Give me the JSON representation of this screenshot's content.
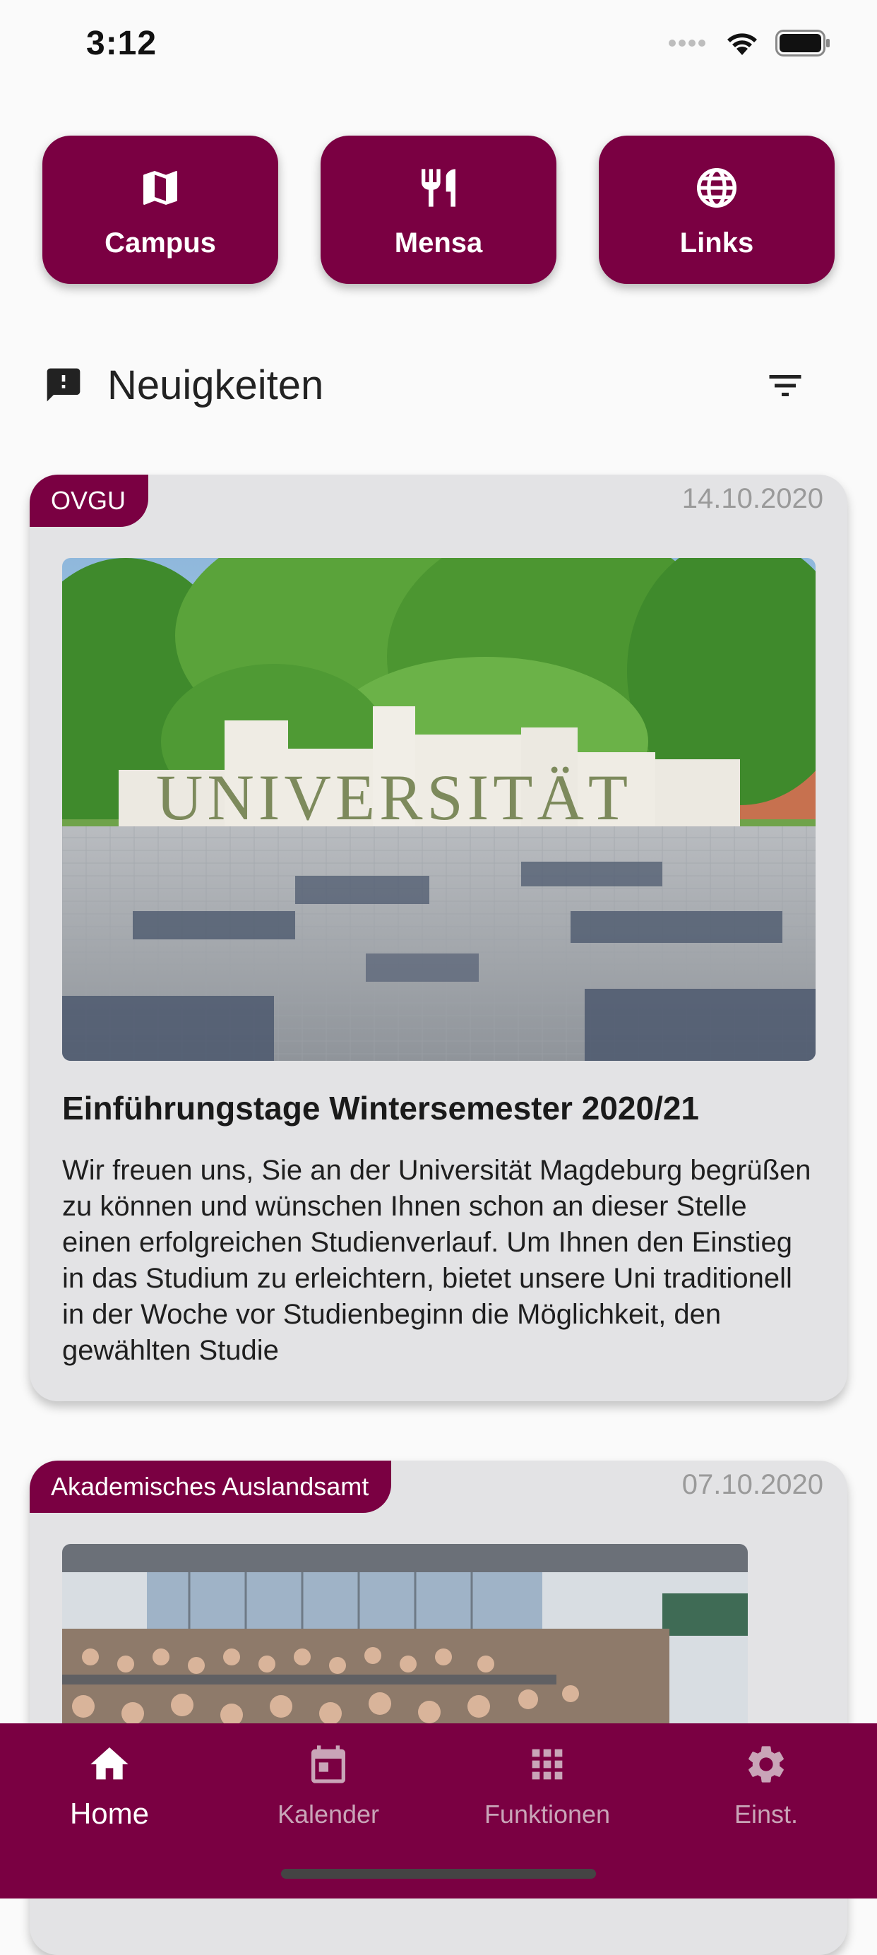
{
  "status_bar": {
    "time": "3:12"
  },
  "quick_actions": [
    {
      "label": "Campus",
      "icon": "map-icon"
    },
    {
      "label": "Mensa",
      "icon": "cutlery-icon"
    },
    {
      "label": "Links",
      "icon": "globe-icon"
    }
  ],
  "news_section": {
    "title": "Neuigkeiten",
    "icon": "feedback-icon",
    "filter_icon": "filter-icon"
  },
  "news": [
    {
      "tag": "OVGU",
      "date": "14.10.2020",
      "image": "UNIVERSITÄT campus sculpture",
      "headline": "Einführungstage Wintersemester 2020/21",
      "excerpt": "Wir freuen uns, Sie an der Universität Magdeburg begrüßen zu können und wünschen Ihnen schon an dieser Stelle einen erfolgreichen Studienverlauf. Um Ihnen den Einstieg in das Studium zu erleichtern, bietet unsere Uni traditionell in der Woche vor Studienbeginn die Möglichkeit, den gewählten Studie"
    },
    {
      "tag": "Akademisches Auslandsamt",
      "date": "07.10.2020",
      "image": "lecture hall full of students"
    }
  ],
  "bottom_nav": [
    {
      "label": "Home",
      "icon": "home-icon",
      "active": true
    },
    {
      "label": "Kalender",
      "icon": "calendar-icon",
      "active": false
    },
    {
      "label": "Funktionen",
      "icon": "grid-icon",
      "active": false
    },
    {
      "label": "Einst.",
      "icon": "gear-icon",
      "active": false
    }
  ],
  "colors": {
    "primary": "#7a0042",
    "card_bg": "#e3e3e5",
    "page_bg": "#fafafa",
    "date_text": "#9a9a9a"
  }
}
